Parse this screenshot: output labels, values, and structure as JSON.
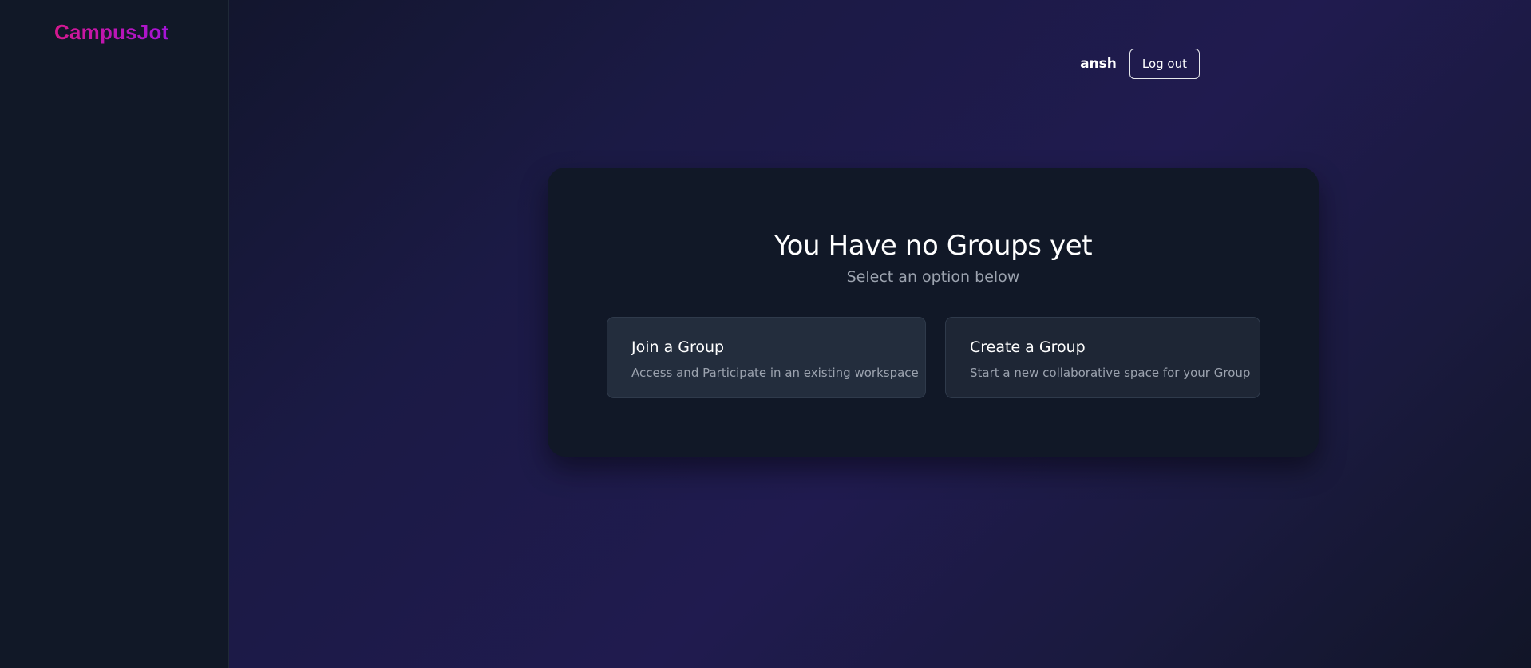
{
  "app": {
    "logo": "CampusJot"
  },
  "header": {
    "username": "ansh",
    "logout_label": "Log out"
  },
  "main": {
    "title": "You Have no Groups yet",
    "subtitle": "Select an option below",
    "options": [
      {
        "title": "Join a Group",
        "description": "Access and Participate in an existing workspace"
      },
      {
        "title": "Create a Group",
        "description": "Start a new collaborative space for your Group"
      }
    ]
  },
  "colors": {
    "logo_gradient_start": "#d6188e",
    "logo_gradient_end": "#a414d8",
    "sidebar_bg": "#111827",
    "card_bg": "#111827",
    "page_bg_accent": "#201b4f"
  }
}
